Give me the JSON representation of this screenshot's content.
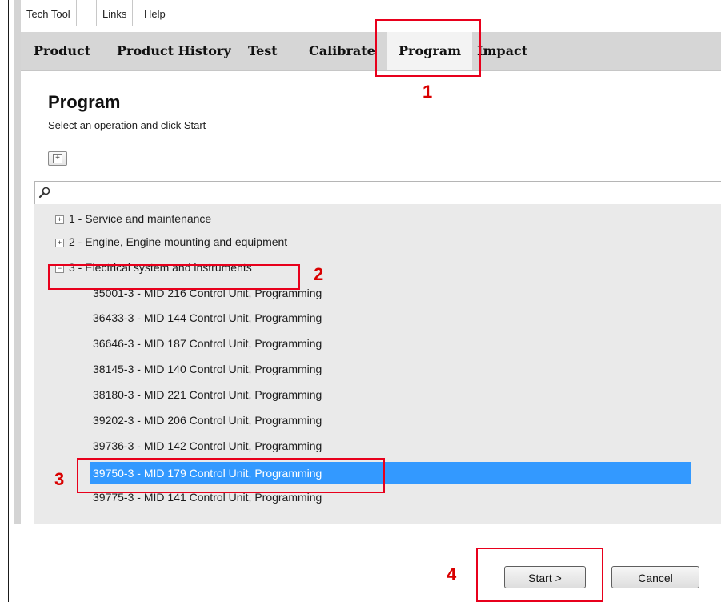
{
  "menu": {
    "items": [
      "Tech Tool",
      "Links",
      "Help"
    ]
  },
  "tabs": [
    {
      "label": "Product"
    },
    {
      "label": "Product History"
    },
    {
      "label": "Test"
    },
    {
      "label": "Calibrate"
    },
    {
      "label": "Program",
      "active": true
    },
    {
      "label": "Impact"
    }
  ],
  "page": {
    "title": "Program",
    "instruction": "Select an operation and click Start",
    "expand_all_symbol": "+"
  },
  "search": {
    "value": "",
    "icon": "search-icon"
  },
  "tree": {
    "groups": [
      {
        "label": "1 - Service and maintenance",
        "expanded": false,
        "toggle": "+"
      },
      {
        "label": "2 - Engine, Engine mounting and equipment",
        "expanded": false,
        "toggle": "+"
      },
      {
        "label": "3 - Electrical system and instruments",
        "expanded": true,
        "toggle": "−"
      }
    ],
    "operations": [
      "35001-3 - MID 216 Control Unit, Programming",
      "36433-3 - MID 144 Control Unit, Programming",
      "36646-3 - MID 187 Control Unit, Programming",
      "38145-3 - MID 140 Control Unit, Programming",
      "38180-3 - MID 221 Control Unit, Programming",
      "39202-3 - MID 206 Control Unit, Programming",
      "39736-3 - MID 142 Control Unit, Programming",
      "39750-3 - MID 179 Control Unit, Programming",
      "39775-3 - MID 141 Control Unit, Programming"
    ],
    "selected_operation": "39750-3 - MID 179 Control Unit, Programming"
  },
  "buttons": {
    "start_label": "Start >",
    "cancel_label": "Cancel"
  },
  "annotations": {
    "step1": "1",
    "step2": "2",
    "step3": "3",
    "step4": "4",
    "color": "#e8001c"
  },
  "colors": {
    "selection": "#3399ff",
    "tabbar": "#d6d6d6",
    "tree_background": "#eaeaea"
  }
}
